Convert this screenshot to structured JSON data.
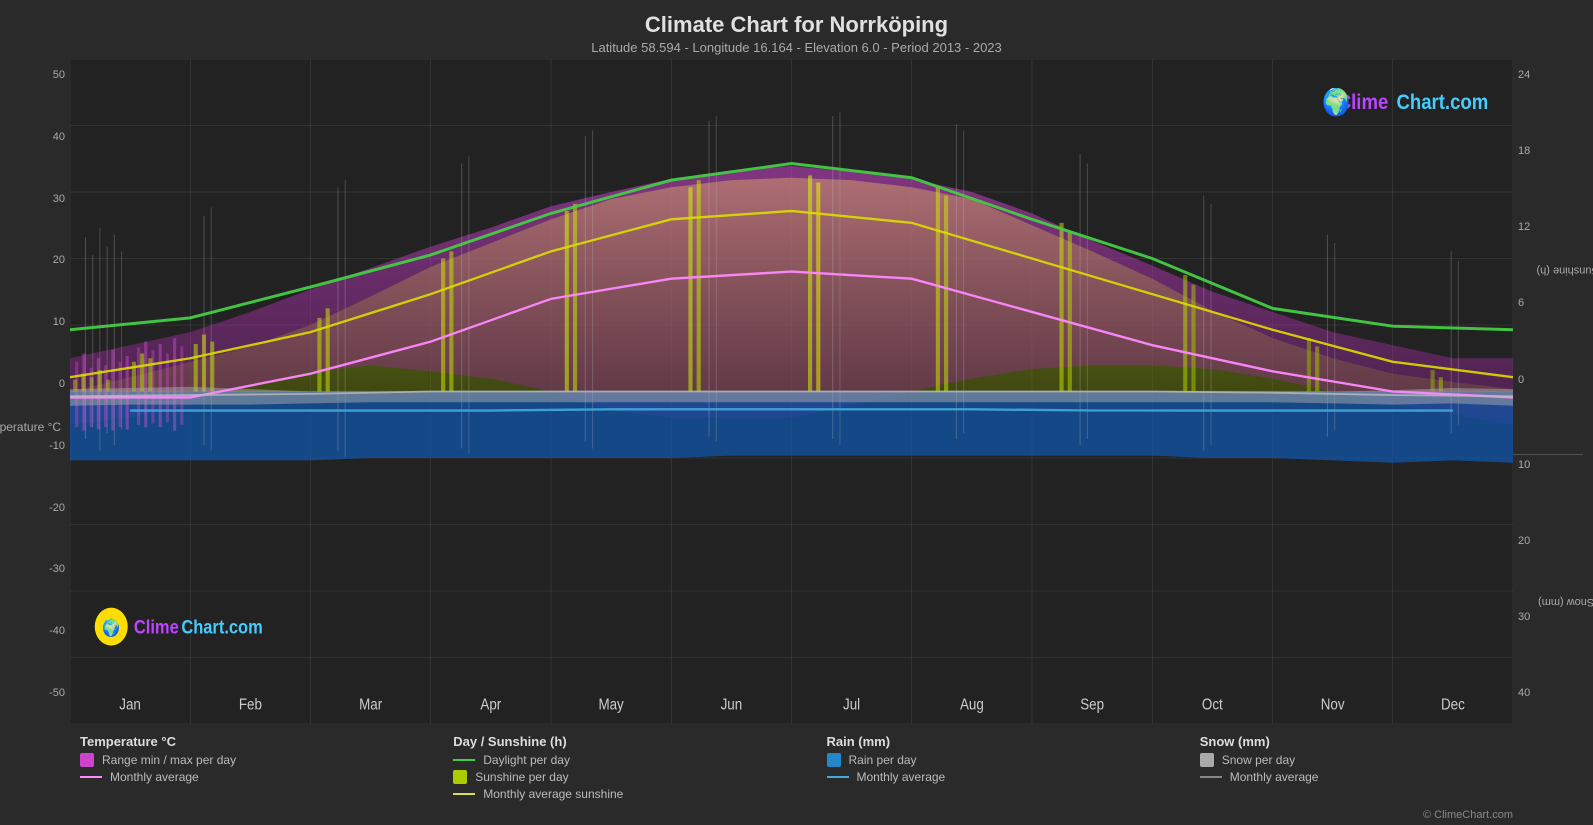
{
  "title": "Climate Chart for Norrköping",
  "subtitle": "Latitude 58.594 - Longitude 16.164 - Elevation 6.0 - Period 2013 - 2023",
  "logo": "ClimeChart.com",
  "copyright": "© ClimeChart.com",
  "yaxis_left": {
    "label": "Temperature °C",
    "ticks": [
      "50",
      "40",
      "30",
      "20",
      "10",
      "0",
      "-10",
      "-20",
      "-30",
      "-40",
      "-50"
    ]
  },
  "yaxis_right_top": {
    "label": "Day / Sunshine (h)",
    "ticks": [
      "24",
      "18",
      "12",
      "6",
      "0"
    ]
  },
  "yaxis_right_bottom": {
    "label": "Rain / Snow (mm)",
    "ticks": [
      "0",
      "10",
      "20",
      "30",
      "40"
    ]
  },
  "x_months": [
    "Jan",
    "Feb",
    "Mar",
    "Apr",
    "May",
    "Jun",
    "Jul",
    "Aug",
    "Sep",
    "Oct",
    "Nov",
    "Dec"
  ],
  "legend": {
    "temp": {
      "title": "Temperature °C",
      "items": [
        {
          "type": "box",
          "color": "#cc44cc",
          "label": "Range min / max per day"
        },
        {
          "type": "line",
          "color": "#ff88ff",
          "label": "Monthly average"
        }
      ]
    },
    "sunshine": {
      "title": "Day / Sunshine (h)",
      "items": [
        {
          "type": "line",
          "color": "#44cc44",
          "label": "Daylight per day"
        },
        {
          "type": "box",
          "color": "#cccc00",
          "label": "Sunshine per day"
        },
        {
          "type": "line",
          "color": "#dddd44",
          "label": "Monthly average sunshine"
        }
      ]
    },
    "rain": {
      "title": "Rain (mm)",
      "items": [
        {
          "type": "box",
          "color": "#2288cc",
          "label": "Rain per day"
        },
        {
          "type": "line",
          "color": "#44aadd",
          "label": "Monthly average"
        }
      ]
    },
    "snow": {
      "title": "Snow (mm)",
      "items": [
        {
          "type": "box",
          "color": "#aaaaaa",
          "label": "Snow per day"
        },
        {
          "type": "line",
          "color": "#888888",
          "label": "Monthly average"
        }
      ]
    }
  }
}
